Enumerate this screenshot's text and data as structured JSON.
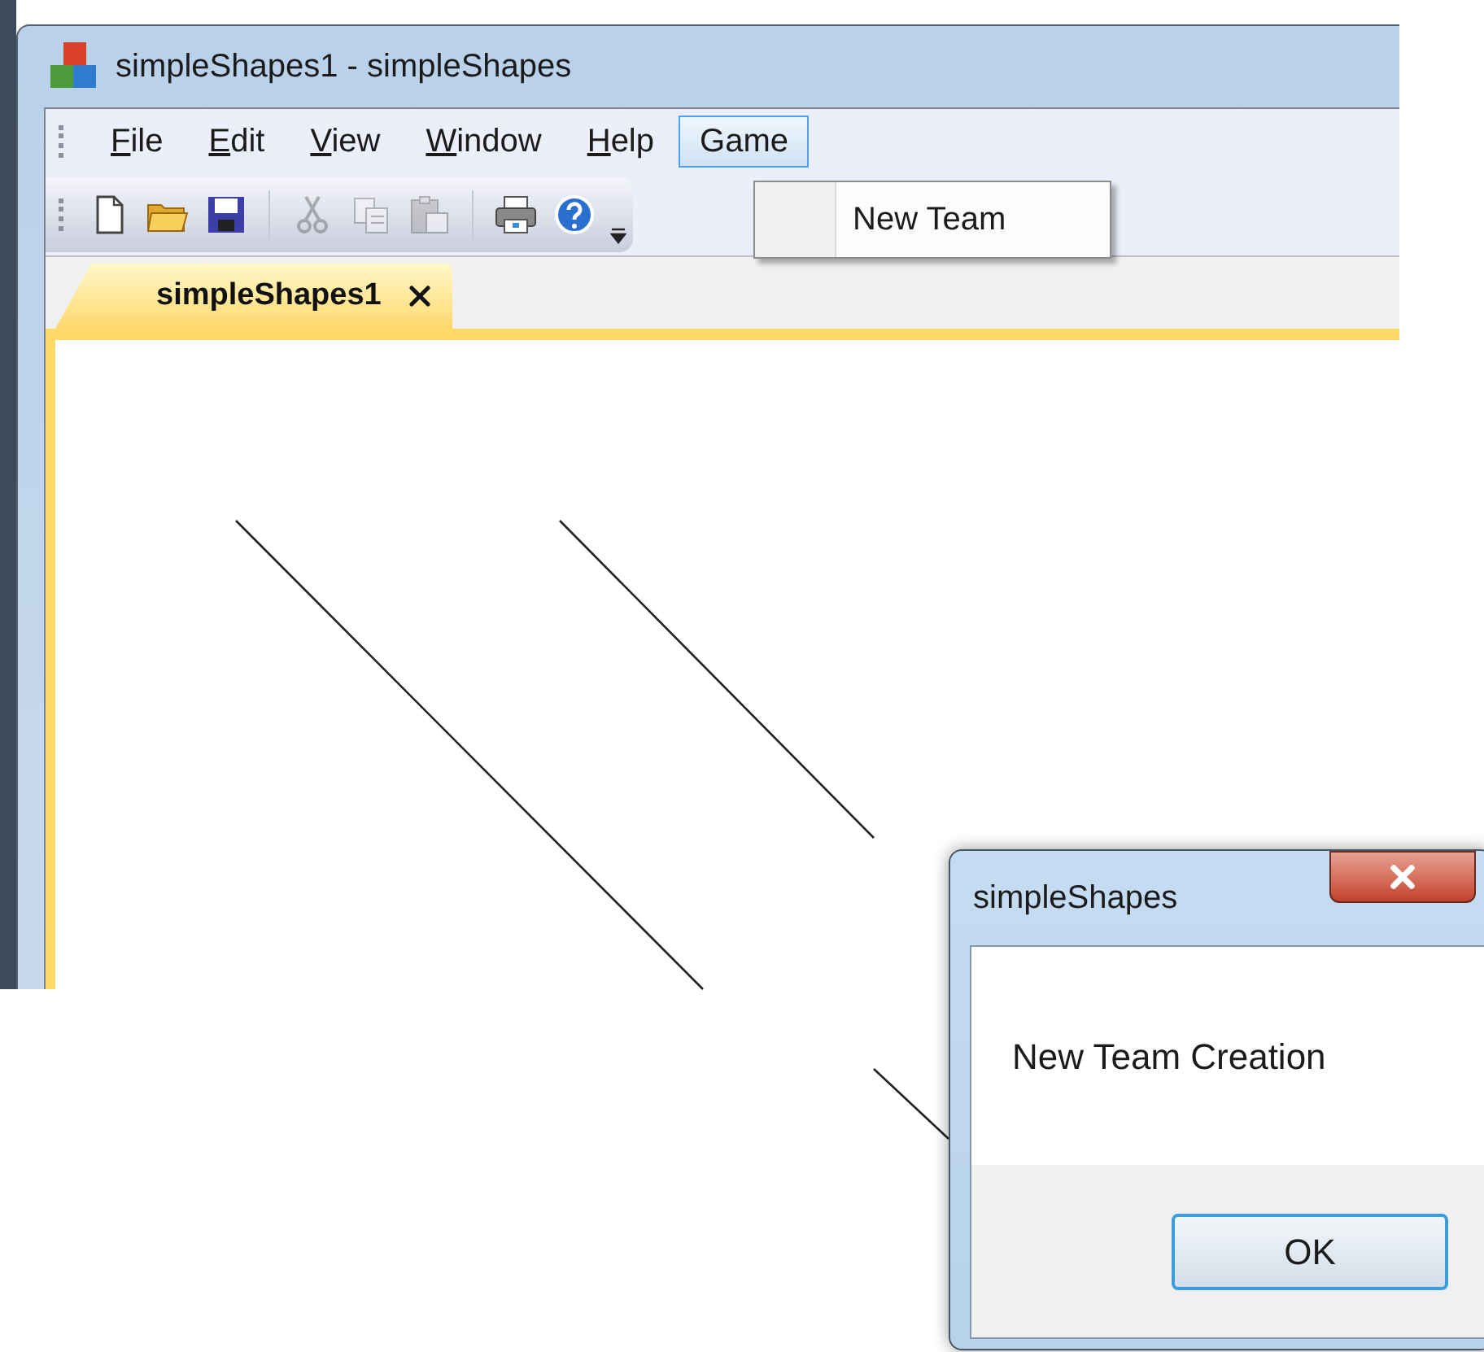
{
  "window": {
    "title": "simpleShapes1 - simpleShapes"
  },
  "menu": [
    {
      "label": "File",
      "mnemonic": true,
      "selected": false
    },
    {
      "label": "Edit",
      "mnemonic": true,
      "selected": false
    },
    {
      "label": "View",
      "mnemonic": true,
      "selected": false
    },
    {
      "label": "Window",
      "mnemonic": true,
      "selected": false
    },
    {
      "label": "Help",
      "mnemonic": true,
      "selected": false
    },
    {
      "label": "Game",
      "mnemonic": false,
      "selected": true
    }
  ],
  "open_menu": {
    "items": [
      {
        "label": "New Team"
      }
    ]
  },
  "toolbar": [
    {
      "kind": "new",
      "disabled": false
    },
    {
      "kind": "open",
      "disabled": false
    },
    {
      "kind": "save",
      "disabled": false
    },
    {
      "kind": "separator"
    },
    {
      "kind": "cut",
      "disabled": true
    },
    {
      "kind": "copy",
      "disabled": true
    },
    {
      "kind": "paste",
      "disabled": true
    },
    {
      "kind": "separator"
    },
    {
      "kind": "print",
      "disabled": false
    },
    {
      "kind": "help",
      "disabled": false
    }
  ],
  "tabs": [
    {
      "label": "simpleShapes1",
      "selected": true
    }
  ],
  "dialog": {
    "title": "simpleShapes",
    "message": "New Team Creation",
    "buttons": [
      "OK"
    ]
  }
}
